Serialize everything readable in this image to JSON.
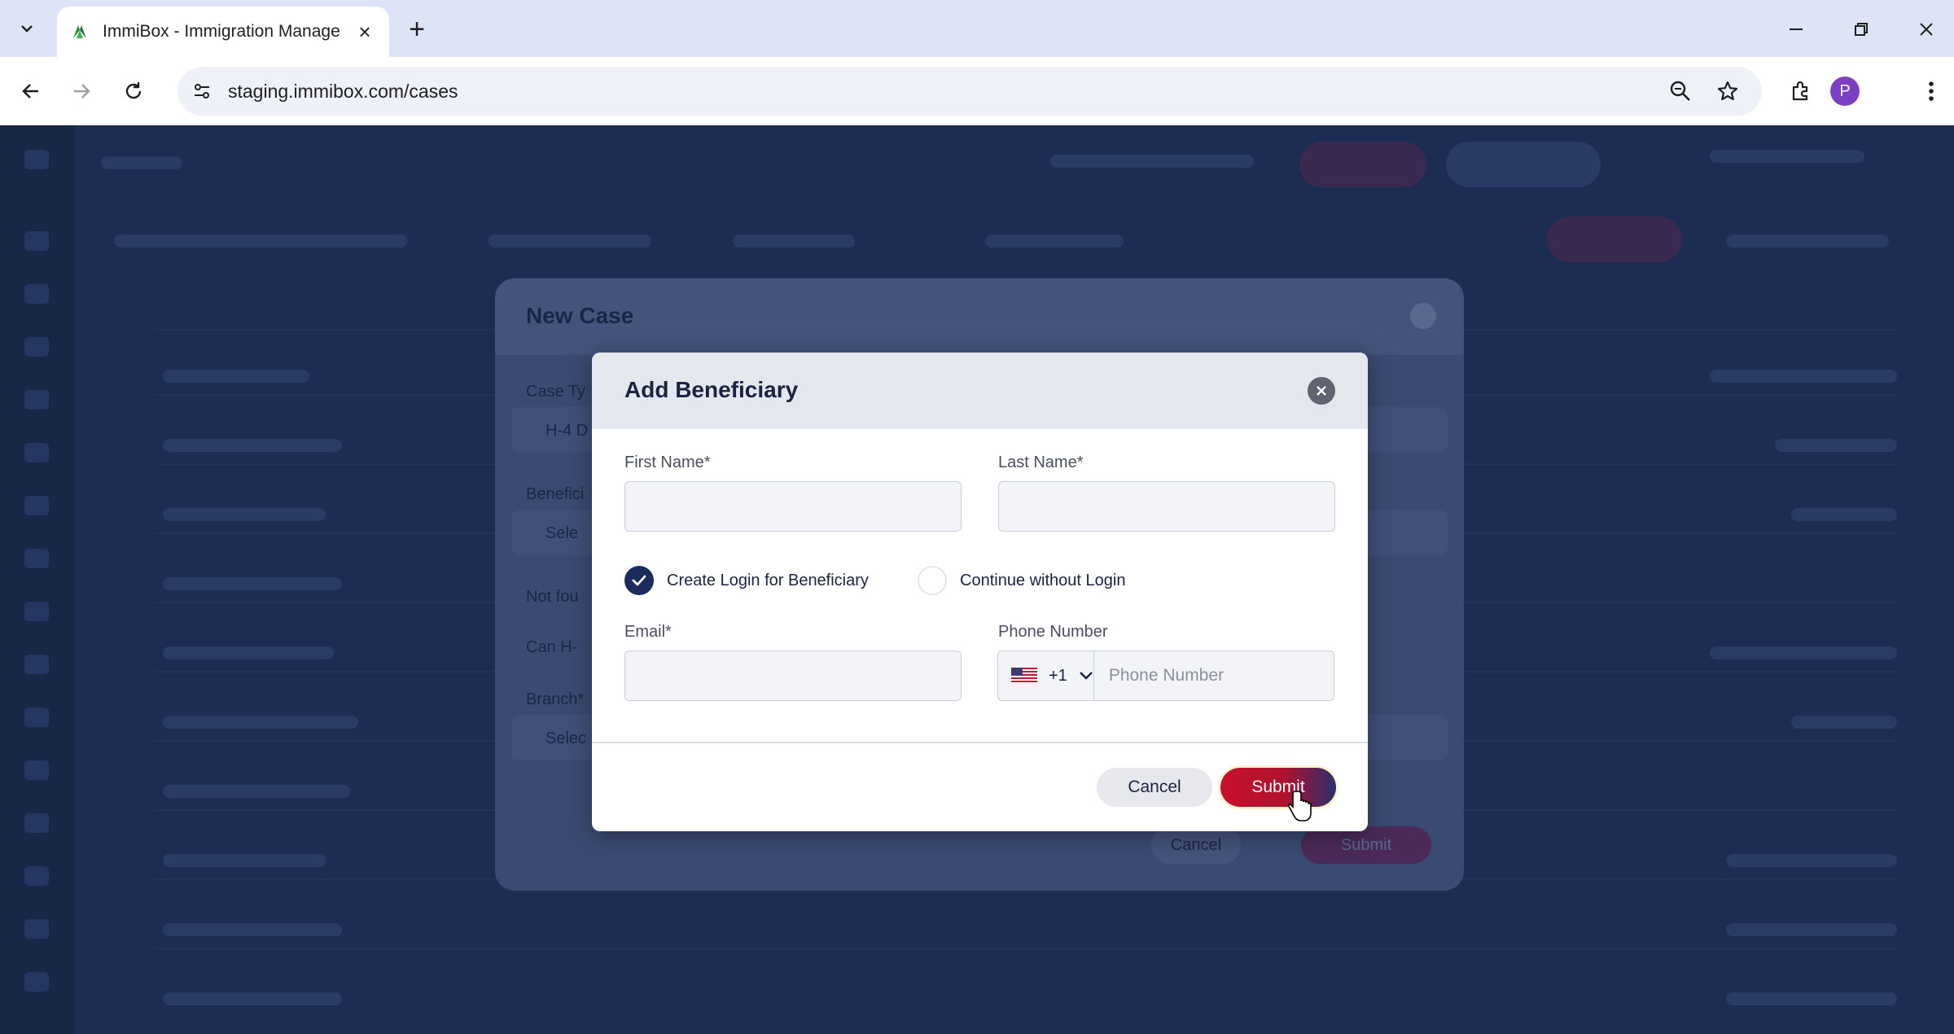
{
  "browser": {
    "tab_title": "ImmiBox - Immigration Manage",
    "url": "staging.immibox.com/cases",
    "profile_initial": "P"
  },
  "background_modal": {
    "title": "New Case",
    "field_labels": [
      "Case Ty",
      "Benefici",
      "Not fou",
      "Can H-",
      "Branch*"
    ],
    "case_type_value": "H-4 D",
    "beneficiary_placeholder": "Sele",
    "branch_placeholder": "Selec",
    "cancel_label": "Cancel",
    "submit_label": "Submit"
  },
  "dialog": {
    "title": "Add Beneficiary",
    "first_name_label": "First Name*",
    "last_name_label": "Last Name*",
    "first_name_value": "",
    "last_name_value": "",
    "login_options": [
      {
        "label": "Create Login for Beneficiary",
        "selected": true
      },
      {
        "label": "Continue without Login",
        "selected": false
      }
    ],
    "email_label": "Email*",
    "email_value": "",
    "phone_label": "Phone Number",
    "phone_country_code": "+1",
    "phone_placeholder": "Phone Number",
    "cancel_label": "Cancel",
    "submit_label": "Submit"
  },
  "colors": {
    "primary_navy": "#1a2b5c",
    "accent_red": "#c8102e"
  }
}
